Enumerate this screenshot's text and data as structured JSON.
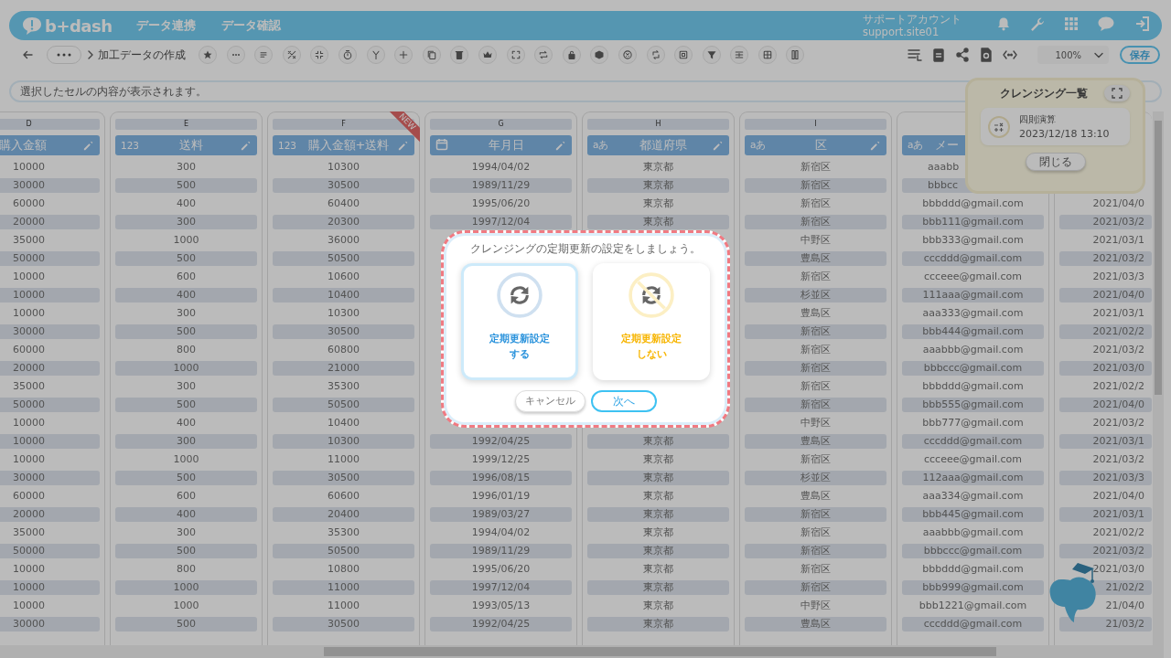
{
  "header": {
    "logo": "b+dash",
    "nav": [
      {
        "label": "データ連携"
      },
      {
        "label": "データ確認"
      }
    ],
    "account": {
      "name": "サポートアカウント",
      "id": "support.site01"
    }
  },
  "toolbar": {
    "breadcrumb": "加工データの作成",
    "zoom": "100%",
    "save": "保存"
  },
  "cell_info": {
    "placeholder": "選択したセルの内容が表示されます。"
  },
  "sheet": {
    "columns": [
      {
        "letter": "D",
        "title": "購入金額",
        "values": [
          "10000",
          "30000",
          "60000",
          "20000",
          "35000",
          "50000",
          "10000",
          "10000",
          "10000",
          "30000",
          "60000",
          "20000",
          "35000",
          "50000",
          "10000",
          "10000",
          "10000",
          "30000",
          "60000",
          "20000",
          "35000",
          "50000",
          "10000",
          "10000",
          "10000",
          "30000"
        ]
      },
      {
        "letter": "E",
        "kind": "number",
        "type_glyph": "123",
        "title": "送料",
        "values": [
          "300",
          "500",
          "400",
          "300",
          "1000",
          "500",
          "600",
          "400",
          "300",
          "500",
          "800",
          "1000",
          "300",
          "500",
          "400",
          "300",
          "1000",
          "500",
          "600",
          "400",
          "300",
          "500",
          "800",
          "1000",
          "1000",
          "500"
        ]
      },
      {
        "letter": "F",
        "kind": "number",
        "type_glyph": "123",
        "title": "購入金額+送料",
        "badge": "NEW",
        "values": [
          "10300",
          "30500",
          "60400",
          "20300",
          "36000",
          "50500",
          "10600",
          "10400",
          "10300",
          "30500",
          "60800",
          "21000",
          "35300",
          "50500",
          "10400",
          "10300",
          "11000",
          "30500",
          "60600",
          "20400",
          "35300",
          "50500",
          "10800",
          "11000",
          "11000",
          "30500"
        ]
      },
      {
        "letter": "G",
        "kind": "date",
        "title": "年月日",
        "values": [
          "1994/04/02",
          "1989/11/29",
          "1995/06/20",
          "1997/12/04"
        ],
        "lower_values": [
          "1992/04/25",
          "1999/12/25",
          "1996/08/15",
          "1996/01/19",
          "1989/03/27",
          "1994/04/02",
          "1989/11/29",
          "1995/06/20",
          "1997/12/04",
          "1993/05/13",
          "1992/04/25"
        ]
      },
      {
        "letter": "H",
        "kind": "text",
        "type_glyph": "aあ",
        "title": "都道府県",
        "values": [
          "東京都",
          "東京都",
          "東京都",
          "東京都"
        ],
        "lower_values": [
          "東京都",
          "東京都",
          "東京都",
          "東京都",
          "東京都",
          "東京都",
          "東京都",
          "東京都",
          "東京都",
          "東京都",
          "東京都"
        ]
      },
      {
        "letter": "I",
        "kind": "text",
        "type_glyph": "aあ",
        "title": "区",
        "values": [
          "新宿区",
          "新宿区",
          "新宿区",
          "新宿区",
          "中野区",
          "豊島区",
          "新宿区",
          "杉並区",
          "豊島区",
          "新宿区",
          "新宿区",
          "新宿区",
          "新宿区",
          "新宿区",
          "中野区",
          "豊島区",
          "新宿区",
          "杉並区",
          "豊島区",
          "新宿区",
          "新宿区",
          "新宿区",
          "新宿区",
          "新宿区",
          "中野区",
          "豊島区"
        ]
      },
      {
        "kind": "text",
        "type_glyph": "aあ",
        "title": "メー",
        "values": [
          "aaabb",
          "bbbcc",
          "bbbddd@gmail.com",
          "bbb111@gmail.com",
          "bbb333@gmail.com",
          "cccddd@gmail.com",
          "ccceee@gmail.com",
          "111aaa@gmail.com",
          "aaa333@gmail.com",
          "bbb444@gmail.com",
          "aaabbb@gmail.com",
          "bbbccc@gmail.com",
          "bbbddd@gmail.com",
          "bbb555@gmail.com",
          "bbb777@gmail.com",
          "cccddd@gmail.com",
          "ccceee@gmail.com",
          "112aaa@gmail.com",
          "aaa334@gmail.com",
          "bbb445@gmail.com",
          "aaabbb@gmail.com",
          "bbbccc@gmail.com",
          "bbbddd@gmail.com",
          "bbb999@gmail.com",
          "bbb1221@gmail.com",
          "cccddd@gmail.com"
        ]
      },
      {
        "values": [
          "2021/04/0",
          "2021/03/2",
          "2021/03/1",
          "2021/03/2",
          "2021/03/3",
          "2021/04/0",
          "2021/03/1",
          "2021/02/2",
          "2021/03/2",
          "2021/03/0",
          "2021/02/2",
          "2021/04/0",
          "2021/03/2",
          "2021/03/1",
          "2021/03/2",
          "2021/03/3",
          "2021/04/0",
          "2021/03/1",
          "2021/02/2",
          "2021/03/2",
          "2021/03/0",
          "21/02/2",
          "21/04/0",
          "21/03/2"
        ]
      }
    ]
  },
  "cleansing_panel": {
    "title": "クレンジング一覧",
    "items": [
      {
        "name": "四則演算",
        "time": "2023/12/18 13:10"
      }
    ],
    "close": "閉じる"
  },
  "dialog": {
    "title": "クレンジングの定期更新の設定をしましょう。",
    "options": [
      {
        "kind": "enable",
        "line1": "定期更新設定",
        "line2": "する",
        "selected": true
      },
      {
        "kind": "disable",
        "line1": "定期更新設定",
        "line2": "しない",
        "selected": false
      }
    ],
    "buttons": [
      {
        "kind": "cancel",
        "label": "キャンセル"
      },
      {
        "kind": "primary",
        "label": "次へ"
      }
    ]
  }
}
